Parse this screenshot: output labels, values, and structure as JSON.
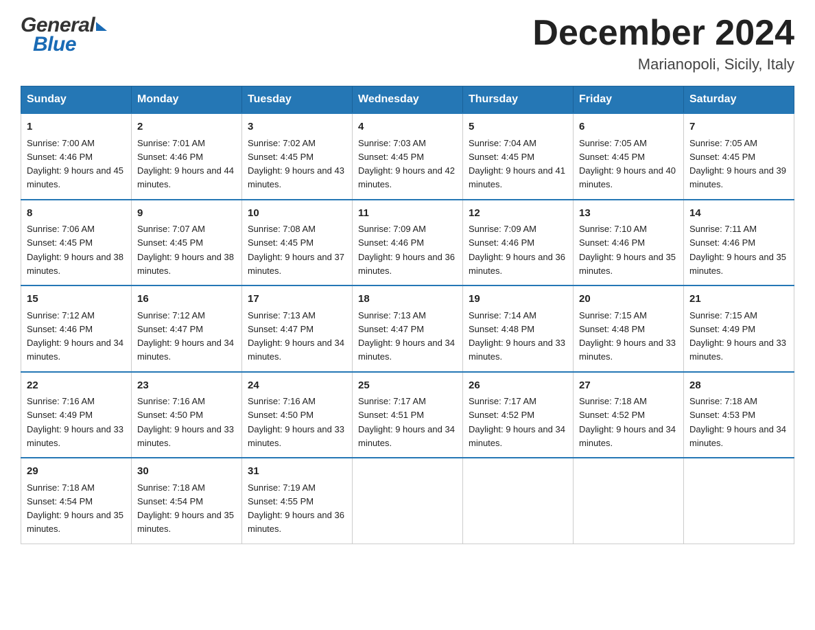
{
  "header": {
    "logo_general": "General",
    "logo_blue": "Blue",
    "month_year": "December 2024",
    "location": "Marianopoli, Sicily, Italy"
  },
  "columns": [
    "Sunday",
    "Monday",
    "Tuesday",
    "Wednesday",
    "Thursday",
    "Friday",
    "Saturday"
  ],
  "weeks": [
    [
      {
        "day": "1",
        "sunrise": "7:00 AM",
        "sunset": "4:46 PM",
        "daylight": "9 hours and 45 minutes."
      },
      {
        "day": "2",
        "sunrise": "7:01 AM",
        "sunset": "4:46 PM",
        "daylight": "9 hours and 44 minutes."
      },
      {
        "day": "3",
        "sunrise": "7:02 AM",
        "sunset": "4:45 PM",
        "daylight": "9 hours and 43 minutes."
      },
      {
        "day": "4",
        "sunrise": "7:03 AM",
        "sunset": "4:45 PM",
        "daylight": "9 hours and 42 minutes."
      },
      {
        "day": "5",
        "sunrise": "7:04 AM",
        "sunset": "4:45 PM",
        "daylight": "9 hours and 41 minutes."
      },
      {
        "day": "6",
        "sunrise": "7:05 AM",
        "sunset": "4:45 PM",
        "daylight": "9 hours and 40 minutes."
      },
      {
        "day": "7",
        "sunrise": "7:05 AM",
        "sunset": "4:45 PM",
        "daylight": "9 hours and 39 minutes."
      }
    ],
    [
      {
        "day": "8",
        "sunrise": "7:06 AM",
        "sunset": "4:45 PM",
        "daylight": "9 hours and 38 minutes."
      },
      {
        "day": "9",
        "sunrise": "7:07 AM",
        "sunset": "4:45 PM",
        "daylight": "9 hours and 38 minutes."
      },
      {
        "day": "10",
        "sunrise": "7:08 AM",
        "sunset": "4:45 PM",
        "daylight": "9 hours and 37 minutes."
      },
      {
        "day": "11",
        "sunrise": "7:09 AM",
        "sunset": "4:46 PM",
        "daylight": "9 hours and 36 minutes."
      },
      {
        "day": "12",
        "sunrise": "7:09 AM",
        "sunset": "4:46 PM",
        "daylight": "9 hours and 36 minutes."
      },
      {
        "day": "13",
        "sunrise": "7:10 AM",
        "sunset": "4:46 PM",
        "daylight": "9 hours and 35 minutes."
      },
      {
        "day": "14",
        "sunrise": "7:11 AM",
        "sunset": "4:46 PM",
        "daylight": "9 hours and 35 minutes."
      }
    ],
    [
      {
        "day": "15",
        "sunrise": "7:12 AM",
        "sunset": "4:46 PM",
        "daylight": "9 hours and 34 minutes."
      },
      {
        "day": "16",
        "sunrise": "7:12 AM",
        "sunset": "4:47 PM",
        "daylight": "9 hours and 34 minutes."
      },
      {
        "day": "17",
        "sunrise": "7:13 AM",
        "sunset": "4:47 PM",
        "daylight": "9 hours and 34 minutes."
      },
      {
        "day": "18",
        "sunrise": "7:13 AM",
        "sunset": "4:47 PM",
        "daylight": "9 hours and 34 minutes."
      },
      {
        "day": "19",
        "sunrise": "7:14 AM",
        "sunset": "4:48 PM",
        "daylight": "9 hours and 33 minutes."
      },
      {
        "day": "20",
        "sunrise": "7:15 AM",
        "sunset": "4:48 PM",
        "daylight": "9 hours and 33 minutes."
      },
      {
        "day": "21",
        "sunrise": "7:15 AM",
        "sunset": "4:49 PM",
        "daylight": "9 hours and 33 minutes."
      }
    ],
    [
      {
        "day": "22",
        "sunrise": "7:16 AM",
        "sunset": "4:49 PM",
        "daylight": "9 hours and 33 minutes."
      },
      {
        "day": "23",
        "sunrise": "7:16 AM",
        "sunset": "4:50 PM",
        "daylight": "9 hours and 33 minutes."
      },
      {
        "day": "24",
        "sunrise": "7:16 AM",
        "sunset": "4:50 PM",
        "daylight": "9 hours and 33 minutes."
      },
      {
        "day": "25",
        "sunrise": "7:17 AM",
        "sunset": "4:51 PM",
        "daylight": "9 hours and 34 minutes."
      },
      {
        "day": "26",
        "sunrise": "7:17 AM",
        "sunset": "4:52 PM",
        "daylight": "9 hours and 34 minutes."
      },
      {
        "day": "27",
        "sunrise": "7:18 AM",
        "sunset": "4:52 PM",
        "daylight": "9 hours and 34 minutes."
      },
      {
        "day": "28",
        "sunrise": "7:18 AM",
        "sunset": "4:53 PM",
        "daylight": "9 hours and 34 minutes."
      }
    ],
    [
      {
        "day": "29",
        "sunrise": "7:18 AM",
        "sunset": "4:54 PM",
        "daylight": "9 hours and 35 minutes."
      },
      {
        "day": "30",
        "sunrise": "7:18 AM",
        "sunset": "4:54 PM",
        "daylight": "9 hours and 35 minutes."
      },
      {
        "day": "31",
        "sunrise": "7:19 AM",
        "sunset": "4:55 PM",
        "daylight": "9 hours and 36 minutes."
      },
      null,
      null,
      null,
      null
    ]
  ]
}
